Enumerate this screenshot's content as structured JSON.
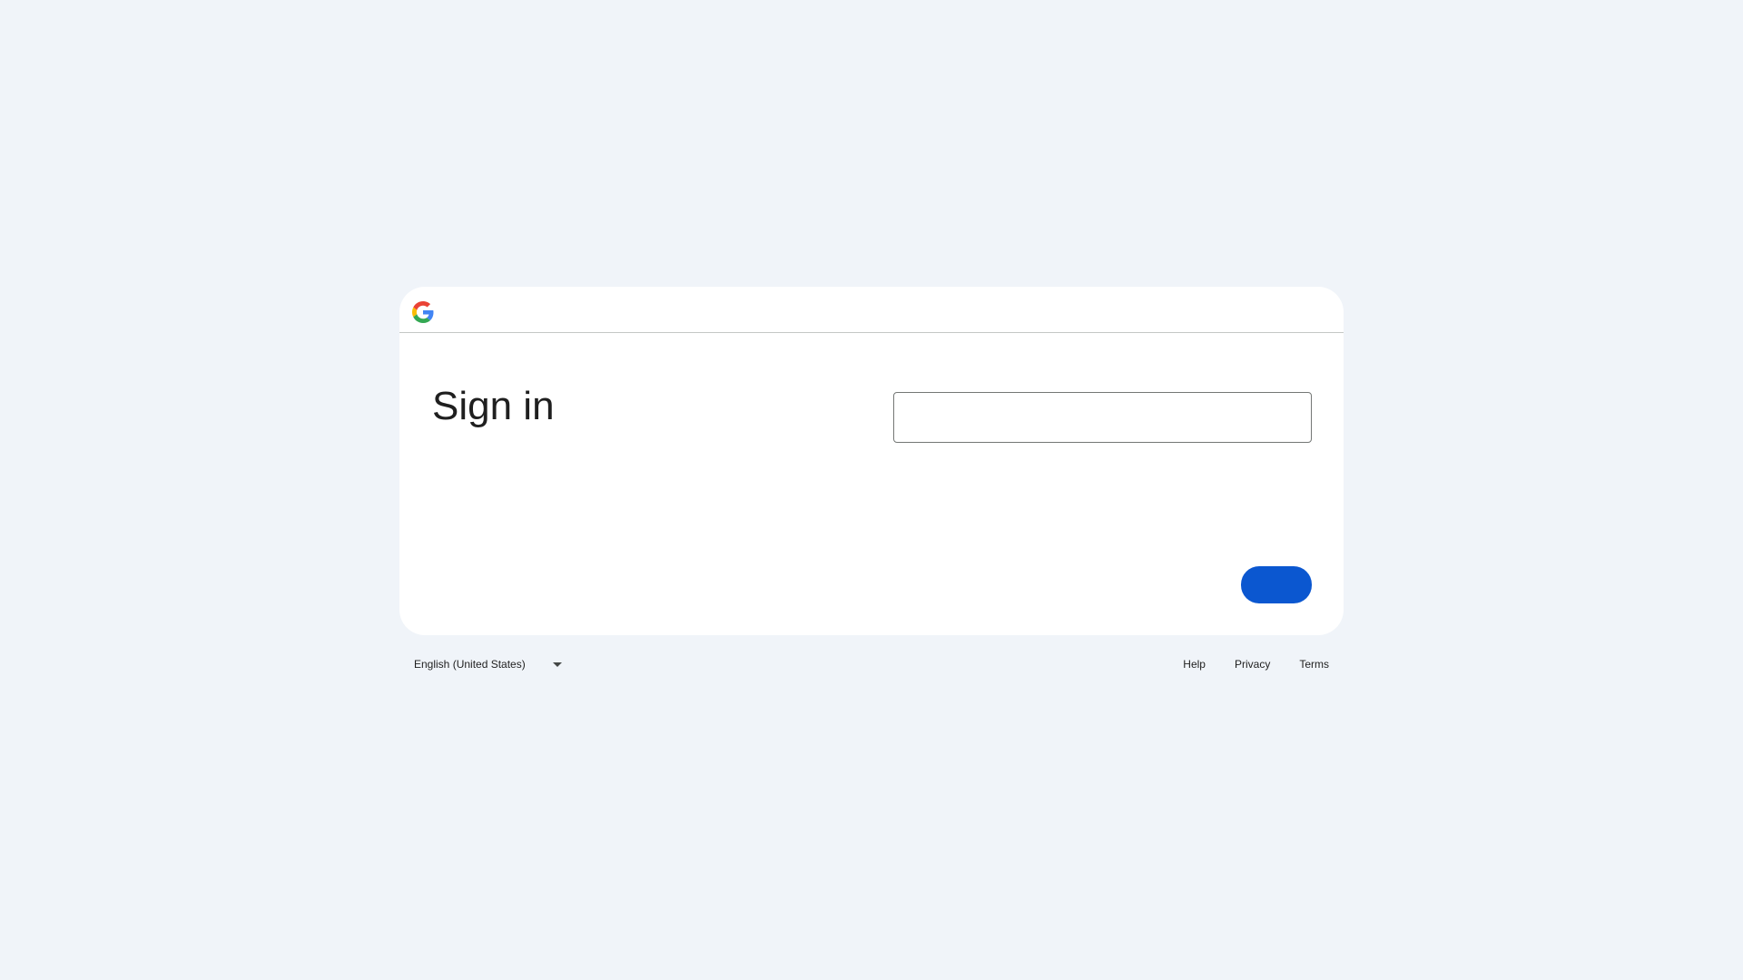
{
  "login": {
    "title": "Sign in",
    "identifier_value": "",
    "identifier_placeholder": "",
    "next_label": ""
  },
  "footer": {
    "language": "English (United States)",
    "links": [
      "Help",
      "Privacy",
      "Terms"
    ]
  },
  "colors": {
    "background": "#f0f4f9",
    "card": "#ffffff",
    "primary_button": "#0b57d0",
    "input_border": "#747775",
    "divider": "#c4c7c5"
  },
  "icons": {
    "logo": "google-g-logo-icon",
    "dropdown": "caret-down-icon"
  }
}
